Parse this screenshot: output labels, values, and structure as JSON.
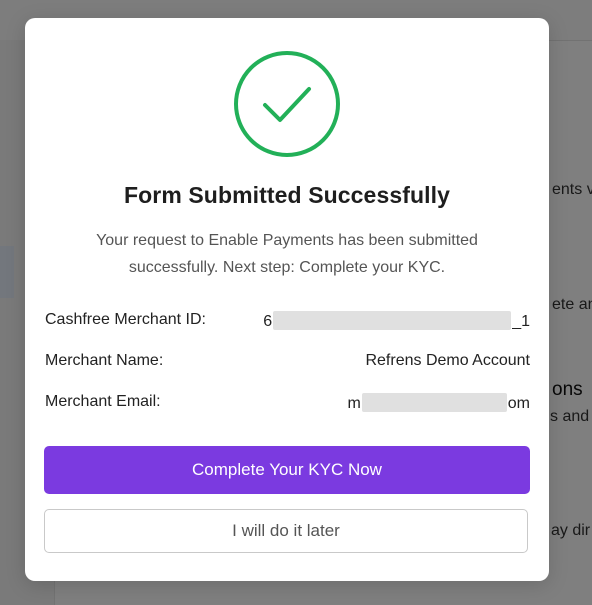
{
  "background": {
    "fragments": [
      "ents v",
      "ete an",
      "ons",
      "s and r",
      "ay dir"
    ]
  },
  "modal": {
    "success_icon": "check-circle-icon",
    "title": "Form Submitted Successfully",
    "subtitle": "Your request to Enable Payments has been submitted successfully. Next step: Complete your KYC.",
    "details": {
      "merchant_id_label": "Cashfree Merchant ID:",
      "merchant_id_prefix": "6",
      "merchant_id_suffix": "_1",
      "merchant_name_label": "Merchant Name:",
      "merchant_name_value": "Refrens Demo Account",
      "merchant_email_label": "Merchant Email:",
      "merchant_email_prefix": "m",
      "merchant_email_suffix": "om"
    },
    "primary_button": "Complete Your KYC Now",
    "secondary_button": "I will do it later"
  },
  "colors": {
    "success_green": "#22b058",
    "primary_purple": "#7b3ae0",
    "overlay": "rgba(0,0,0,0.5)"
  }
}
